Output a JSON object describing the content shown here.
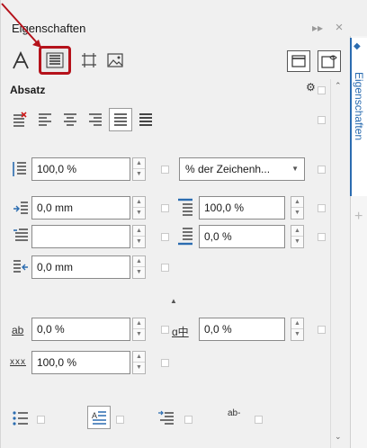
{
  "docker": {
    "title": "Eigenschaften",
    "pin_glyph": "▸▸",
    "close_glyph": "×"
  },
  "tabs": {
    "character_icon": "text-A-icon",
    "paragraph_icon": "paragraph-lines-icon",
    "frame_icon": "frame-icon",
    "image_icon": "image-icon"
  },
  "section": {
    "title": "Absatz"
  },
  "fields": {
    "line_spacing": "100,0 %",
    "line_spacing_unit": "% der Zeichenh...",
    "indent_left": "0,0 mm",
    "before_paragraph": "100,0 %",
    "first_line": "",
    "after_paragraph": "0,0 %",
    "indent_right": "0,0 mm",
    "char_spacing": "0,0 %",
    "lang_spacing": "0,0 %",
    "word_spacing": "100,0 %"
  },
  "side_tab": {
    "label": "Eigenschaften"
  },
  "glyphs": {
    "ab": "ab",
    "lang": "ɑ中",
    "xxx": "xxx",
    "hyph": "ab-"
  },
  "colors": {
    "accent": "#2b6cb0",
    "highlight": "#b5121b"
  }
}
